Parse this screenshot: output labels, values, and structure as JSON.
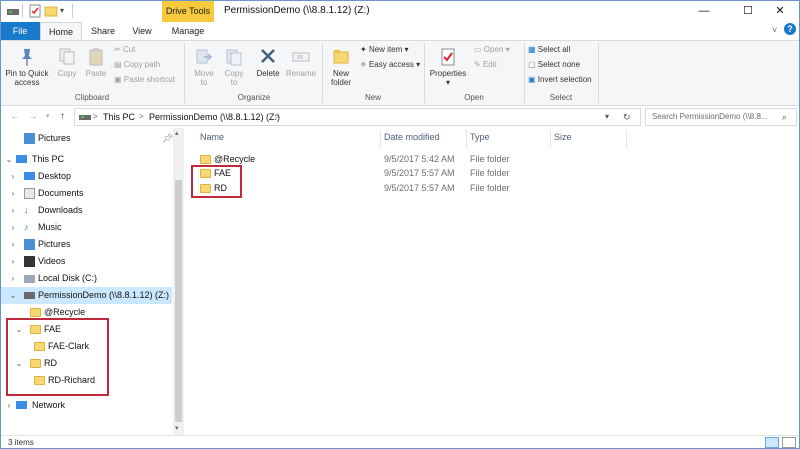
{
  "titlebar": {
    "context_tab": "Drive Tools",
    "title": "PermissionDemo (\\\\8.8.1.12) (Z:)",
    "minimize": "—",
    "maximize": "☐",
    "close": "✕"
  },
  "tabs": {
    "file": "File",
    "home": "Home",
    "share": "Share",
    "view": "View",
    "manage": "Manage"
  },
  "ribbon": {
    "clipboard": {
      "label": "Clipboard",
      "pin_line1": "Pin to Quick",
      "pin_line2": "access",
      "copy": "Copy",
      "paste": "Paste",
      "cut": "Cut",
      "copy_path": "Copy path",
      "paste_shortcut": "Paste shortcut"
    },
    "organize": {
      "label": "Organize",
      "move_to_1": "Move",
      "move_to_2": "to",
      "copy_to_1": "Copy",
      "copy_to_2": "to",
      "delete": "Delete",
      "rename": "Rename"
    },
    "new": {
      "label": "New",
      "new_folder_1": "New",
      "new_folder_2": "folder",
      "new_item": "New item",
      "easy_access": "Easy access"
    },
    "open": {
      "label": "Open",
      "properties": "Properties",
      "open": "Open",
      "edit": "Edit"
    },
    "select": {
      "label": "Select",
      "select_all": "Select all",
      "select_none": "Select none",
      "invert": "Invert selection"
    }
  },
  "address": {
    "crumb1": "This PC",
    "sep": ">",
    "crumb2": "PermissionDemo (\\\\8.8.1.12) (Z:)",
    "search_placeholder": "Search PermissionDemo (\\\\8.8..."
  },
  "navpane": {
    "items": [
      {
        "label": "Pictures"
      },
      {
        "label": "This PC"
      },
      {
        "label": "Desktop"
      },
      {
        "label": "Documents"
      },
      {
        "label": "Downloads"
      },
      {
        "label": "Music"
      },
      {
        "label": "Pictures"
      },
      {
        "label": "Videos"
      },
      {
        "label": "Local Disk (C:)"
      },
      {
        "label": "PermissionDemo (\\\\8.8.1.12) (Z:)"
      },
      {
        "label": "@Recycle"
      },
      {
        "label": "FAE"
      },
      {
        "label": "FAE-Clark"
      },
      {
        "label": "RD"
      },
      {
        "label": "RD-Richard"
      },
      {
        "label": "Network"
      }
    ]
  },
  "columns": {
    "name": "Name",
    "date": "Date modified",
    "type": "Type",
    "size": "Size"
  },
  "files": [
    {
      "name": "@Recycle",
      "date": "9/5/2017 5:42 AM",
      "type": "File folder"
    },
    {
      "name": "FAE",
      "date": "9/5/2017 5:57 AM",
      "type": "File folder"
    },
    {
      "name": "RD",
      "date": "9/5/2017 5:57 AM",
      "type": "File folder"
    }
  ],
  "status": {
    "count": "3 items"
  },
  "colors": {
    "accent": "#1979ca",
    "context_tab": "#f6ca3c",
    "highlight_box": "#c0283c",
    "selection": "#cce8ff",
    "folder": "#f8d775"
  }
}
